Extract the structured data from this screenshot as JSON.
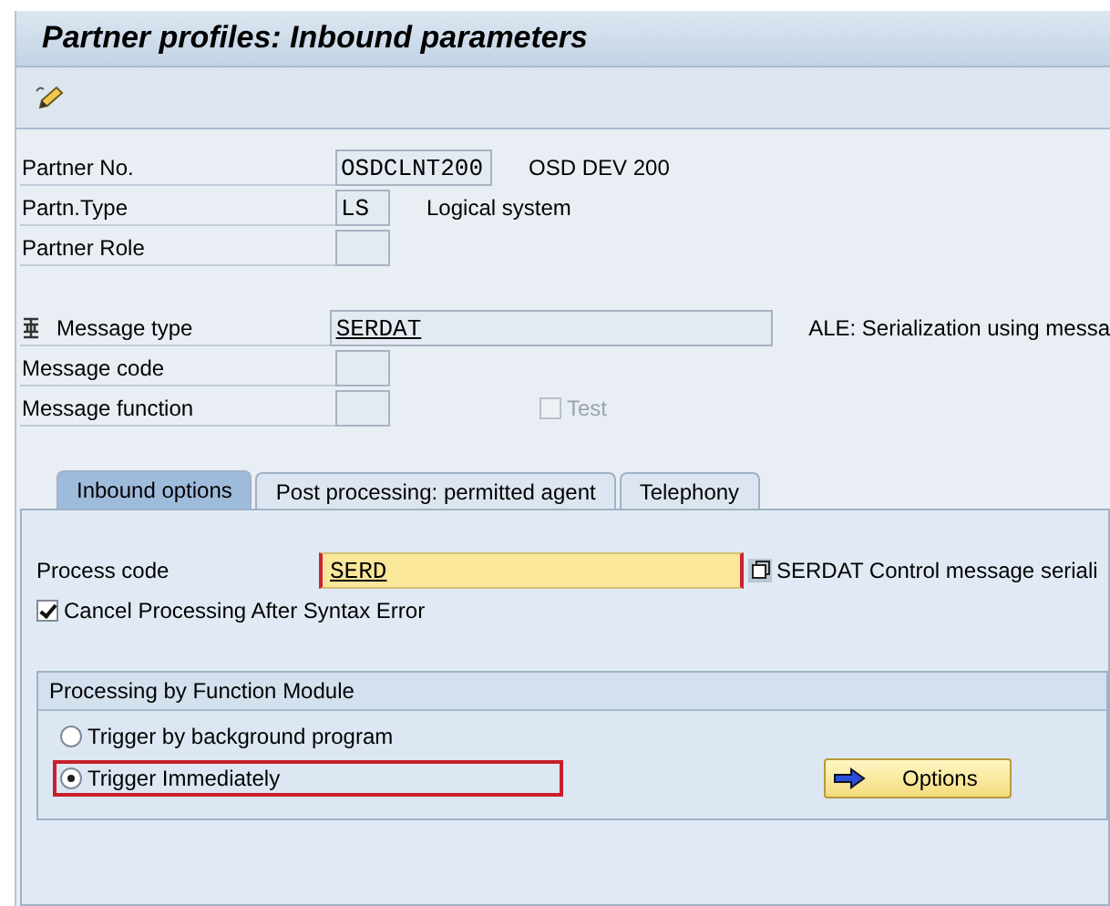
{
  "window": {
    "title": "Partner profiles: Inbound parameters"
  },
  "header_fields": [
    {
      "label": "Partner No.",
      "value": "OSDCLNT200",
      "kind": "long",
      "description": "OSD DEV 200"
    },
    {
      "label": "Partn.Type",
      "value": "LS",
      "kind": "short",
      "description": "Logical system"
    },
    {
      "label": "Partner Role",
      "kind": "short"
    }
  ],
  "message_fields": [
    {
      "label": "Message type",
      "value": "SERDAT",
      "kind": "wide",
      "description": "ALE: Serialization using messa",
      "link": true
    },
    {
      "label": "Message code",
      "kind": "short"
    },
    {
      "label": "Message function",
      "kind": "short",
      "checkbox": {
        "label": "Test",
        "checked": false,
        "disabled": true
      }
    }
  ],
  "tabs": [
    {
      "label": "Inbound options",
      "selected": true
    },
    {
      "label": "Post processing: permitted agent",
      "selected": false
    },
    {
      "label": "Telephony",
      "selected": false
    }
  ],
  "process_code": {
    "label": "Process code",
    "value": "SERD",
    "description": "SERDAT Control message seriali"
  },
  "cancel_option": {
    "label": "Cancel Processing After Syntax Error",
    "checked": true
  },
  "group": {
    "title": "Processing by Function Module",
    "options": [
      {
        "label": "Trigger by background program",
        "selected": false,
        "highlighted": false
      },
      {
        "label": "Trigger Immediately",
        "selected": true,
        "highlighted": true
      }
    ],
    "button": "Options"
  }
}
